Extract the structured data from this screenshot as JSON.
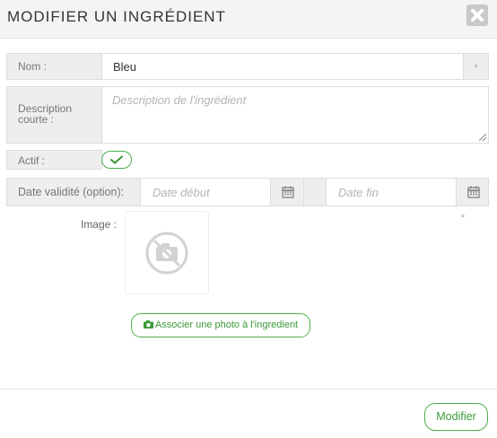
{
  "dialog": {
    "title": "MODIFIER UN INGRÉDIENT",
    "close_icon": "close-icon"
  },
  "form": {
    "nom": {
      "label": "Nom :",
      "value": "Bleu",
      "required_mark": "*"
    },
    "description": {
      "label": "Description courte :",
      "placeholder": "Description de l'ingrédient"
    },
    "actif": {
      "label": "Actif :",
      "checked": true
    },
    "validity": {
      "label": "Date validité (option):",
      "start_placeholder": "Date début",
      "end_placeholder": "Date fin"
    },
    "image": {
      "label": "Image :",
      "required_mark": "*",
      "placeholder_icon": "no-photo-icon"
    },
    "associate_button": "Associer une photo à l'ingredient"
  },
  "footer": {
    "submit_label": "Modifier"
  },
  "colors": {
    "accent": "#4cae4c",
    "label_bg": "#eeeeee"
  }
}
